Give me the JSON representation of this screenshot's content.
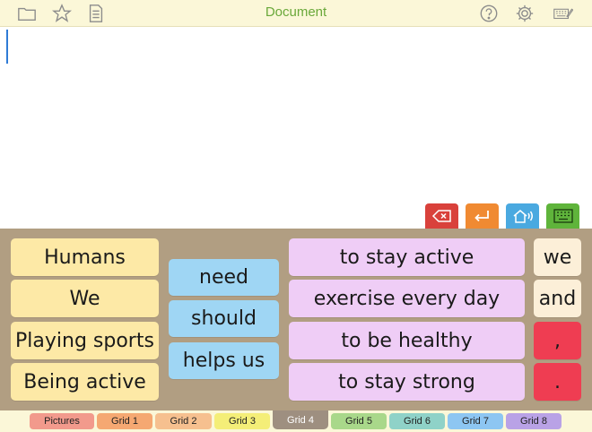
{
  "toolbar": {
    "title": "Document",
    "title_color": "#6aa83a",
    "icons": [
      "folder-icon",
      "star-icon",
      "document-icon",
      "help-icon",
      "gear-icon",
      "keyboard-edit-icon"
    ]
  },
  "document": {
    "text": ""
  },
  "controls": [
    {
      "name": "delete-button",
      "icon": "backspace-icon",
      "color": "#d9413b"
    },
    {
      "name": "enter-button",
      "icon": "return-arrow-icon",
      "color": "#f08a32"
    },
    {
      "name": "speak-button",
      "icon": "home-speaker-icon",
      "color": "#4aa9e0"
    },
    {
      "name": "keyboard-button",
      "icon": "keyboard-icon",
      "color": "#5fb43b"
    }
  ],
  "grid": {
    "column1": [
      "Humans",
      "We",
      "Playing sports",
      "Being active"
    ],
    "column2": [
      "need",
      "should",
      "helps us"
    ],
    "column3": [
      "to stay active",
      "exercise every day",
      "to be healthy",
      "to stay strong"
    ],
    "column4": [
      "we",
      "and",
      ",",
      "."
    ]
  },
  "tabs": [
    {
      "label": "Pictures",
      "color": "#f29a8c"
    },
    {
      "label": "Grid 1",
      "color": "#f5a872"
    },
    {
      "label": "Grid 2",
      "color": "#f6c08f"
    },
    {
      "label": "Grid 3",
      "color": "#f4ee78"
    },
    {
      "label": "Grid 4",
      "color": "#9e8f80",
      "active": true
    },
    {
      "label": "Grid 5",
      "color": "#a9d88a"
    },
    {
      "label": "Grid 6",
      "color": "#8fd2c8"
    },
    {
      "label": "Grid 7",
      "color": "#8dc6f2"
    },
    {
      "label": "Grid 8",
      "color": "#b9a2e6"
    }
  ]
}
